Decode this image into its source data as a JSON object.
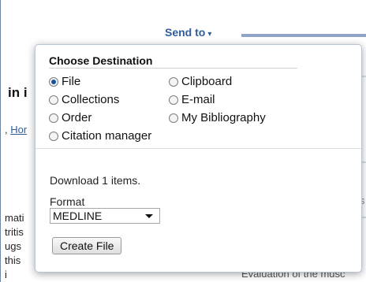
{
  "header": {
    "send_to_label": "Send to",
    "caret": "▾"
  },
  "background": {
    "title_fragment": "in i",
    "authors_prefix": ", ",
    "authors_link": "Hor",
    "snippet_lines": [
      "mati",
      "tritis",
      "ugs",
      "this",
      "i"
    ],
    "bottom_text": "Evaluation of the musc",
    "right_fragment": "s"
  },
  "popup": {
    "title": "Choose Destination",
    "destinations": [
      {
        "label": "File",
        "checked": true
      },
      {
        "label": "Collections",
        "checked": false
      },
      {
        "label": "Order",
        "checked": false
      },
      {
        "label": "Citation manager",
        "checked": false
      },
      {
        "label": "Clipboard",
        "checked": false
      },
      {
        "label": "E-mail",
        "checked": false
      },
      {
        "label": "My Bibliography",
        "checked": false
      }
    ],
    "download_text": "Download 1 items.",
    "format_label": "Format",
    "format_value": "MEDLINE",
    "create_button": "Create File"
  }
}
